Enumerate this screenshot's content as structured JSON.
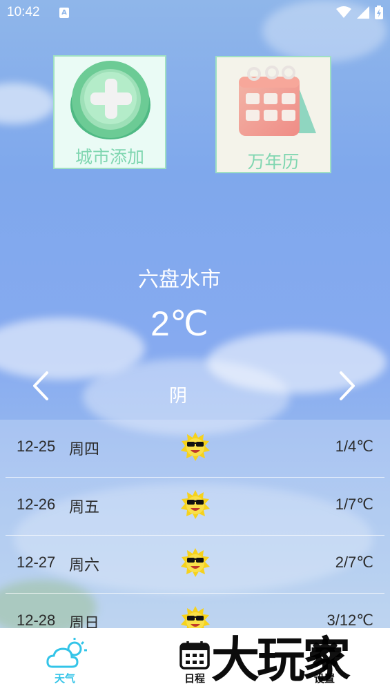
{
  "status_bar": {
    "time": "10:42",
    "notification_glyph": "A"
  },
  "tiles": {
    "add_city": {
      "label": "城市添加",
      "icon": "plus-circle-icon"
    },
    "calendar": {
      "label": "万年历",
      "icon": "calendar-icon"
    }
  },
  "weather": {
    "city": "六盘水市",
    "temperature": "2℃",
    "condition": "阴"
  },
  "forecast": [
    {
      "date": "12-25",
      "day": "周四",
      "icon": "sunny-face-icon",
      "range": "1/4℃"
    },
    {
      "date": "12-26",
      "day": "周五",
      "icon": "sunny-face-icon",
      "range": "1/7℃"
    },
    {
      "date": "12-27",
      "day": "周六",
      "icon": "sunny-face-icon",
      "range": "2/7℃"
    },
    {
      "date": "12-28",
      "day": "周日",
      "icon": "sunny-face-icon",
      "range": "3/12℃"
    }
  ],
  "nav": [
    {
      "label": "天气",
      "icon": "cloud-sun-icon",
      "active": true
    },
    {
      "label": "日程",
      "icon": "calendar-grid-icon",
      "active": false
    },
    {
      "label": "设置",
      "icon": "gear-icon",
      "active": false
    }
  ],
  "watermark": {
    "text": "大玩家"
  },
  "colors": {
    "accent": "#33c4e8",
    "tile_border": "#9fe0c2",
    "tile_text": "#7fd6b0"
  }
}
